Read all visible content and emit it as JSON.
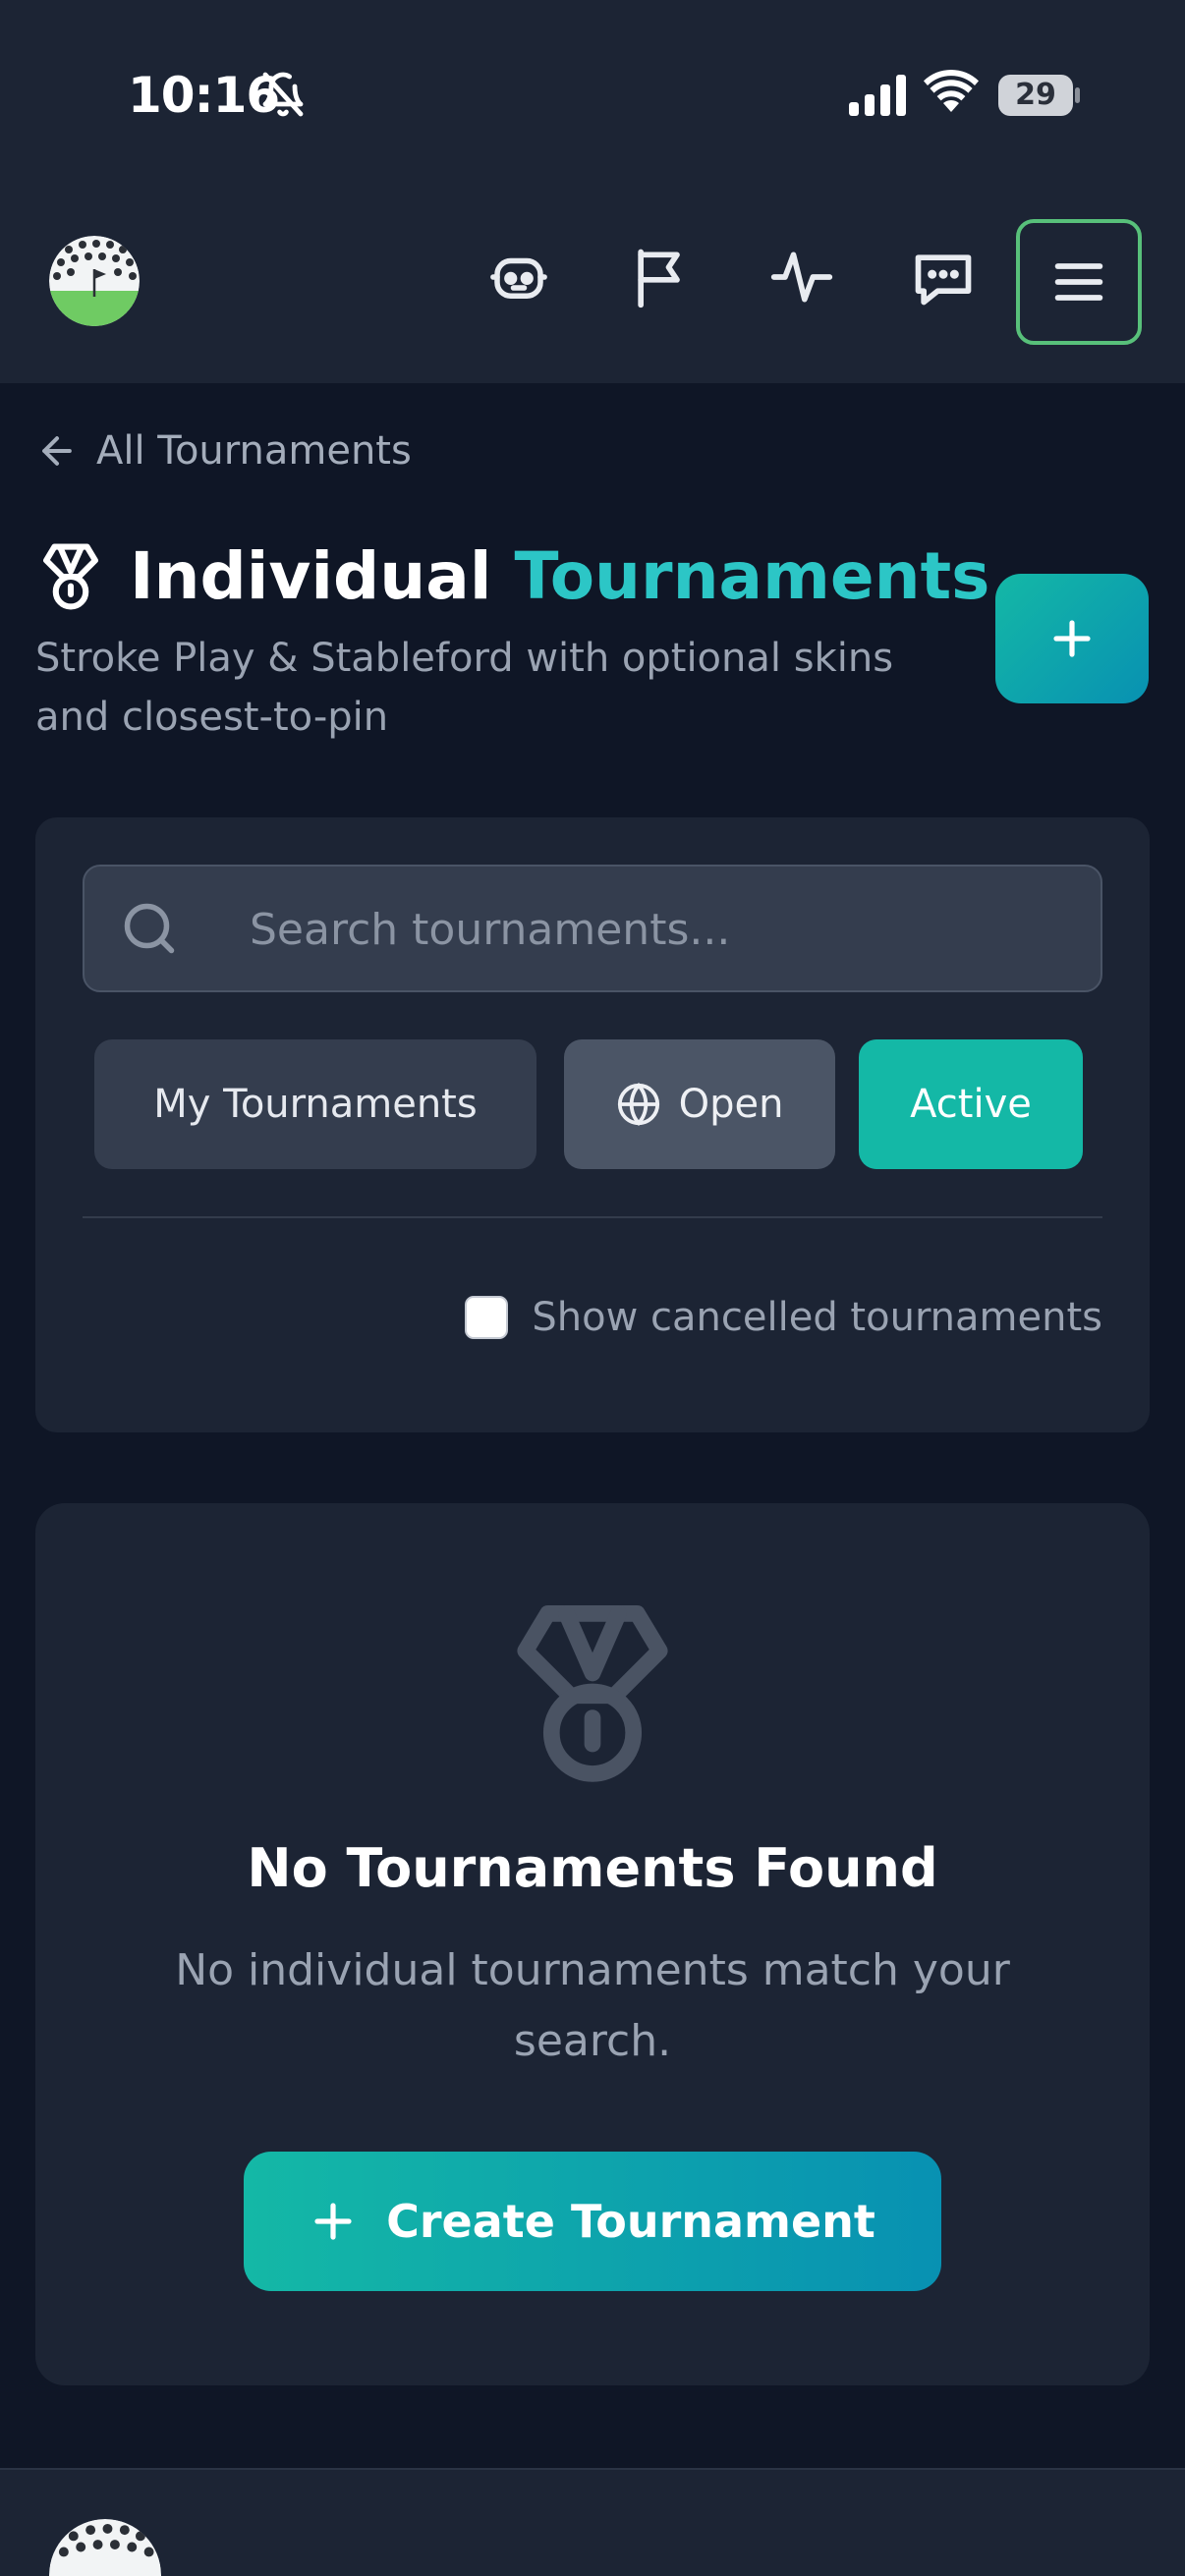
{
  "status_bar": {
    "time": "10:16",
    "battery": "29",
    "icons": [
      "bell-off-icon",
      "signal-icon",
      "wifi-icon",
      "battery-icon"
    ]
  },
  "header": {
    "logo": "golf-ball-logo",
    "icons": [
      "robot-icon",
      "flag-icon",
      "activity-icon",
      "message-icon",
      "menu-icon"
    ],
    "accent_border": "#58c07a"
  },
  "back_link": {
    "label": "All Tournaments"
  },
  "title": {
    "part1": "Individual",
    "part2": "Tournaments",
    "subtitle": "Stroke Play & Stableford with optional skins and closest-to-pin"
  },
  "search": {
    "placeholder": "Search tournaments...",
    "value": ""
  },
  "filters": {
    "my_tournaments": "My Tournaments",
    "open": "Open",
    "active": "Active",
    "selected": "Active"
  },
  "cancelled": {
    "label": "Show cancelled tournaments",
    "checked": false
  },
  "empty_state": {
    "title": "No Tournaments Found",
    "description": "No individual tournaments match your search.",
    "button": "Create Tournament"
  },
  "colors": {
    "background": "#0f1626",
    "surface": "#1c2434",
    "accent": "#14b8a6",
    "accent_text": "#2cc6c6",
    "gradient_end": "#0891b2"
  }
}
